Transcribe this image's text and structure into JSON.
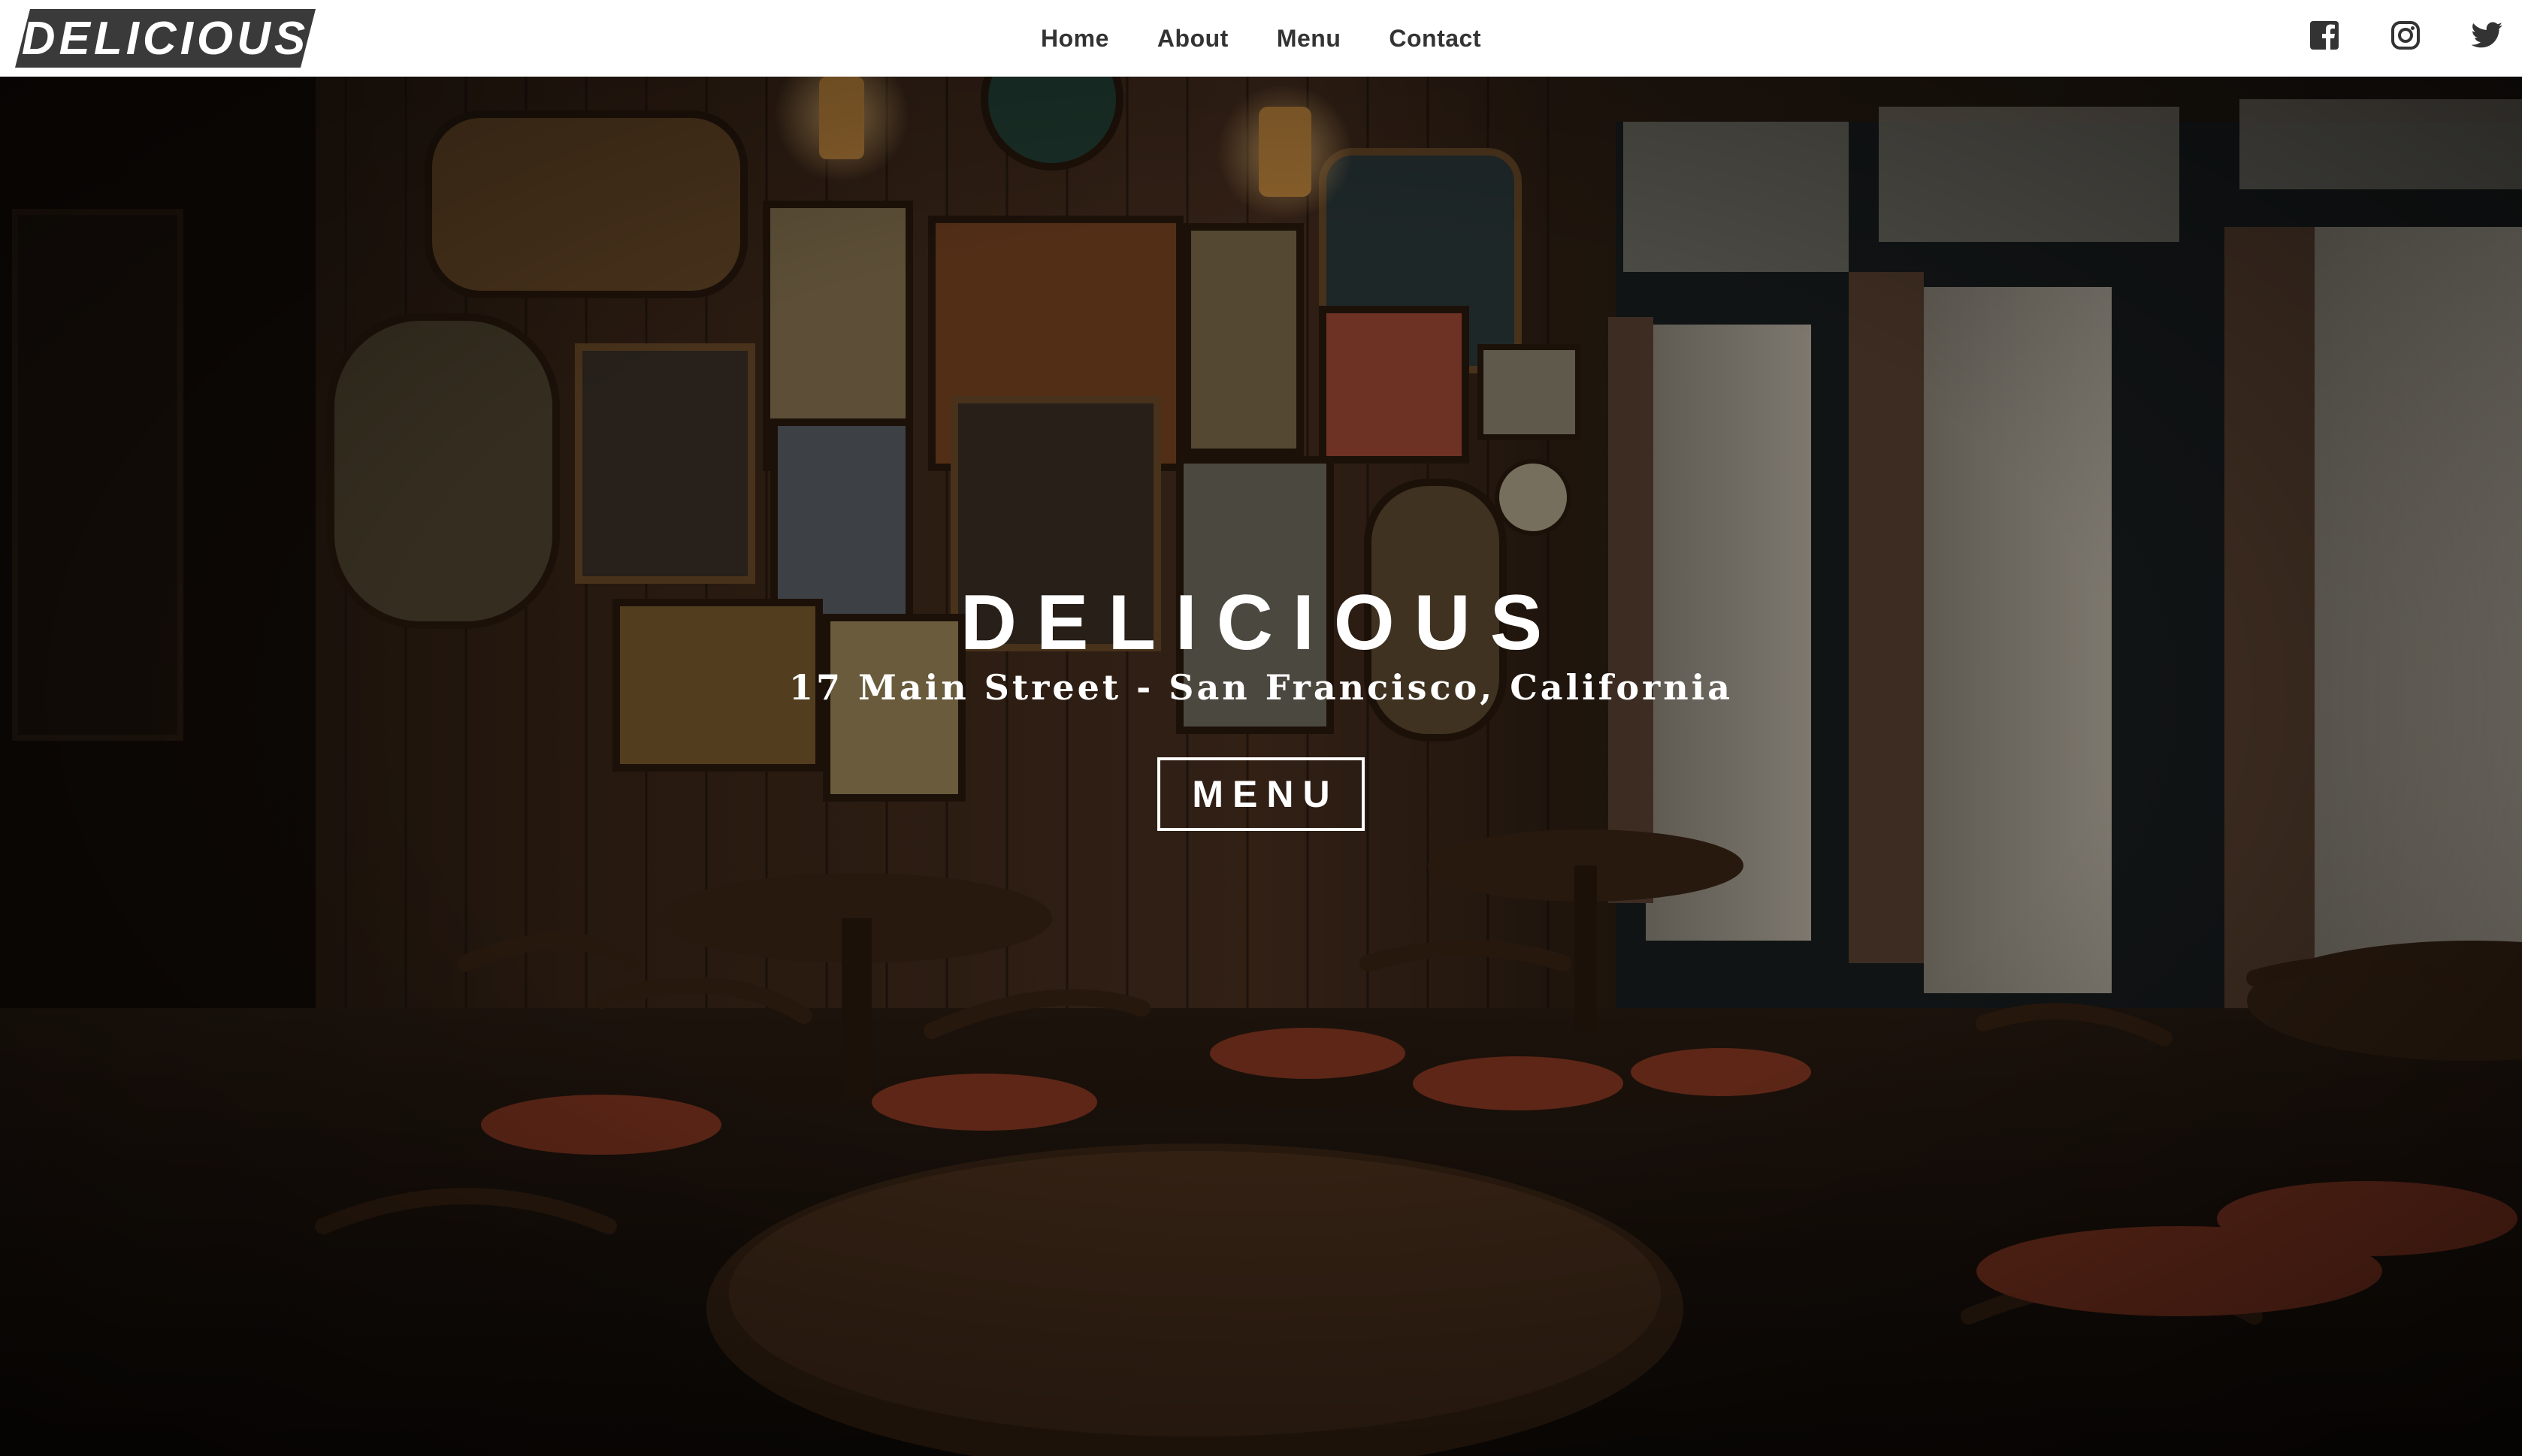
{
  "brand": {
    "logo_text": "DELICIOUS"
  },
  "nav": {
    "items": [
      {
        "label": "Home"
      },
      {
        "label": "About"
      },
      {
        "label": "Menu"
      },
      {
        "label": "Contact"
      }
    ]
  },
  "social": {
    "icons": [
      "facebook-icon",
      "instagram-icon",
      "twitter-icon"
    ]
  },
  "hero": {
    "title": "DELICIOUS",
    "address": "17 Main Street - San Francisco, California",
    "cta_label": "MENU"
  },
  "colors": {
    "header_bg": "#ffffff",
    "nav_text": "#333333",
    "logo_bg": "#3a3a3a",
    "hero_text": "#ffffff"
  }
}
